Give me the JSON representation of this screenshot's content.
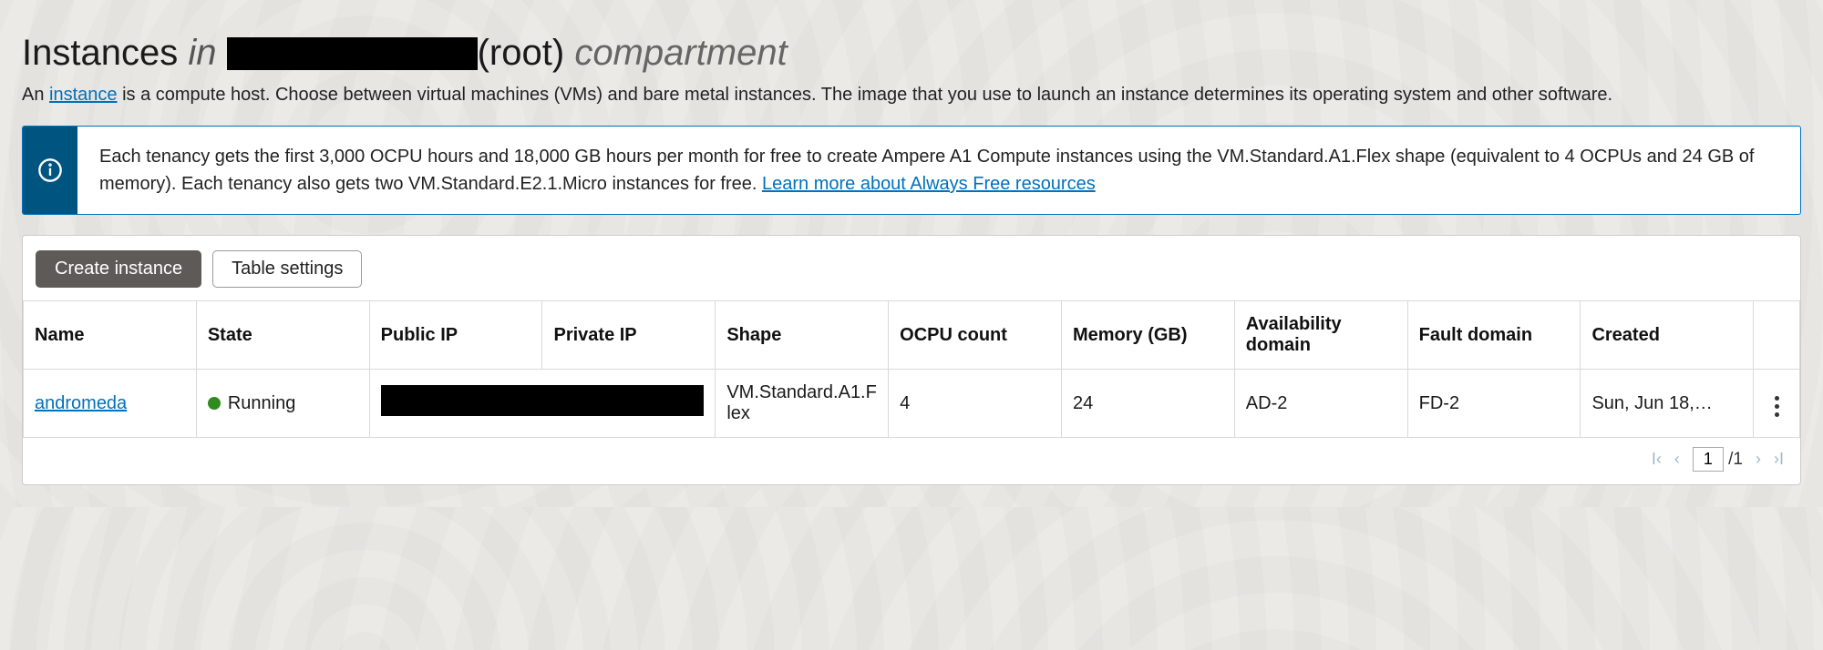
{
  "title": {
    "prefix": "Instances",
    "in": "in",
    "root_suffix": "(root)",
    "compartment": "compartment"
  },
  "description": {
    "before": "An ",
    "link_text": "instance",
    "after": " is a compute host. Choose between virtual machines (VMs) and bare metal instances. The image that you use to launch an instance determines its operating system and other software."
  },
  "banner": {
    "text": "Each tenancy gets the first 3,000 OCPU hours and 18,000 GB hours per month for free to create Ampere A1 Compute instances using the VM.Standard.A1.Flex shape (equivalent to 4 OCPUs and 24 GB of memory). Each tenancy also gets two VM.Standard.E2.1.Micro instances for free. ",
    "link_text": "Learn more about Always Free resources"
  },
  "toolbar": {
    "create_label": "Create instance",
    "settings_label": "Table settings"
  },
  "table": {
    "headers": {
      "name": "Name",
      "state": "State",
      "public_ip": "Public IP",
      "private_ip": "Private IP",
      "shape": "Shape",
      "ocpu": "OCPU count",
      "memory": "Memory (GB)",
      "ad": "Availability domain",
      "fd": "Fault domain",
      "created": "Created"
    },
    "rows": [
      {
        "name": "andromeda",
        "state": "Running",
        "state_color": "#2e8b1e",
        "public_ip": "",
        "private_ip": "",
        "shape": "VM.Standard.A1.Flex",
        "ocpu": "4",
        "memory": "24",
        "ad": "AD-2",
        "fd": "FD-2",
        "created": "Sun, Jun 18,…"
      }
    ]
  },
  "pager": {
    "current": "1",
    "total": "1"
  }
}
